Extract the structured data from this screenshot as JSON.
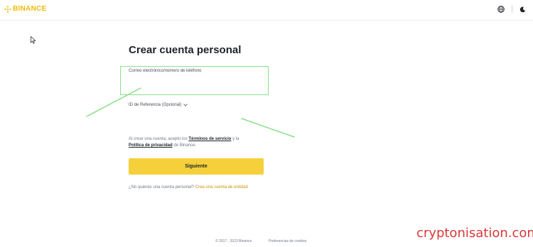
{
  "header": {
    "logo_text": "BINANCE",
    "icons": [
      "globe-icon",
      "moon-icon"
    ]
  },
  "form": {
    "title": "Crear cuenta personal",
    "email_label": "Correo electrónico/número de teléfono",
    "referral_label": "ID de Referencia (Opcional)",
    "terms_prefix": "Al crear una cuenta, acepto los",
    "terms_link": "Términos de servicio",
    "terms_middle": "y la",
    "privacy_link": "Política de privacidad",
    "terms_suffix": "de Binance.",
    "next_button": "Siguiente",
    "business_prompt": "¿No quieres una cuenta personal?",
    "business_link": "Crea una cuenta de entidad"
  },
  "footer": {
    "copyright": "© 2017 - 2023 Binance",
    "cookies": "Preferencias de cookies"
  },
  "watermark": "cryptonisation.com",
  "colors": {
    "accent": "#f0b90b",
    "button": "#f5d03a",
    "highlight": "#8be08b",
    "watermark": "#d9383a"
  }
}
